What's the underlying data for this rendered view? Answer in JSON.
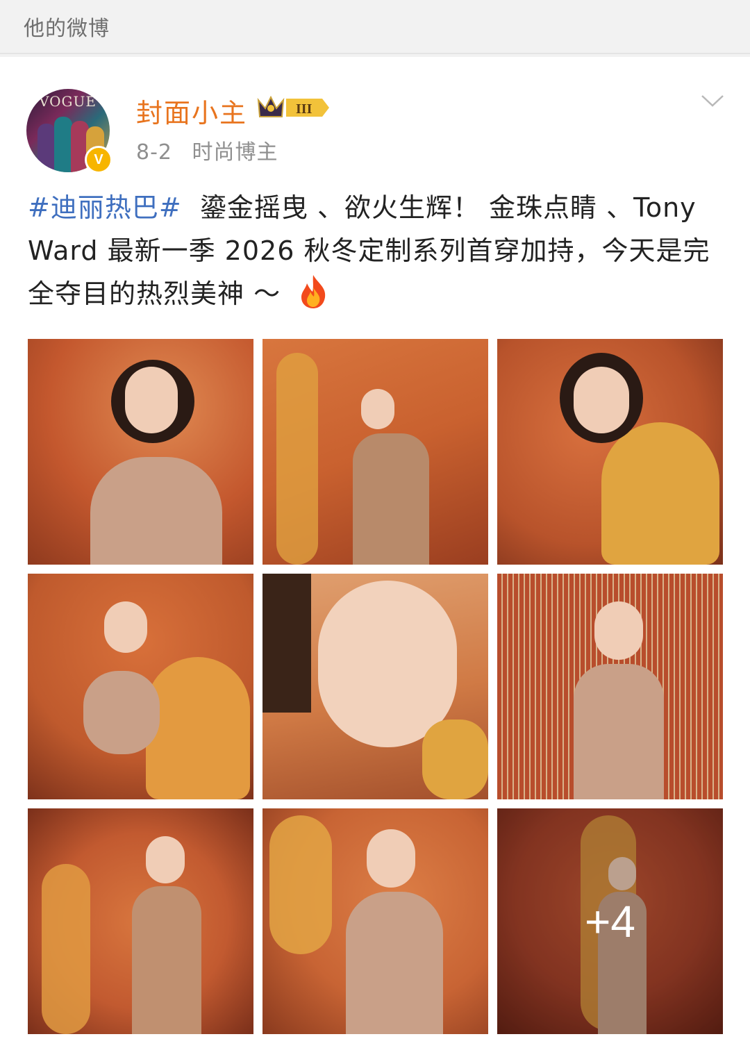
{
  "topbar": {
    "title": "他的微博"
  },
  "post": {
    "author": {
      "name": "封面小主",
      "avatar_text": "VOGUE",
      "verified_mark": "V",
      "level": "III"
    },
    "date": "8-2",
    "category": "时尚博主",
    "hashtag": "#迪丽热巴#",
    "text": "鎏金摇曳 、欲火生辉！ 金珠点睛 、Tony Ward 最新一季 2026 秋冬定制系列首穿加持，今天是完全夺目的热烈美神 ～",
    "emoji": "fire-emoji",
    "more_count": "+4",
    "images": [
      {
        "tone": "#c4582e"
      },
      {
        "tone": "#c9612f"
      },
      {
        "tone": "#b8532b"
      },
      {
        "tone": "#bf5a2d"
      },
      {
        "tone": "#d07a45"
      },
      {
        "tone": "#b84d2c"
      },
      {
        "tone": "#c25a30"
      },
      {
        "tone": "#c86434"
      },
      {
        "tone": "#a7422a"
      }
    ]
  },
  "colors": {
    "accent": "#e8741e",
    "hashtag": "#3f6fbf",
    "badge": "#f7b500"
  }
}
